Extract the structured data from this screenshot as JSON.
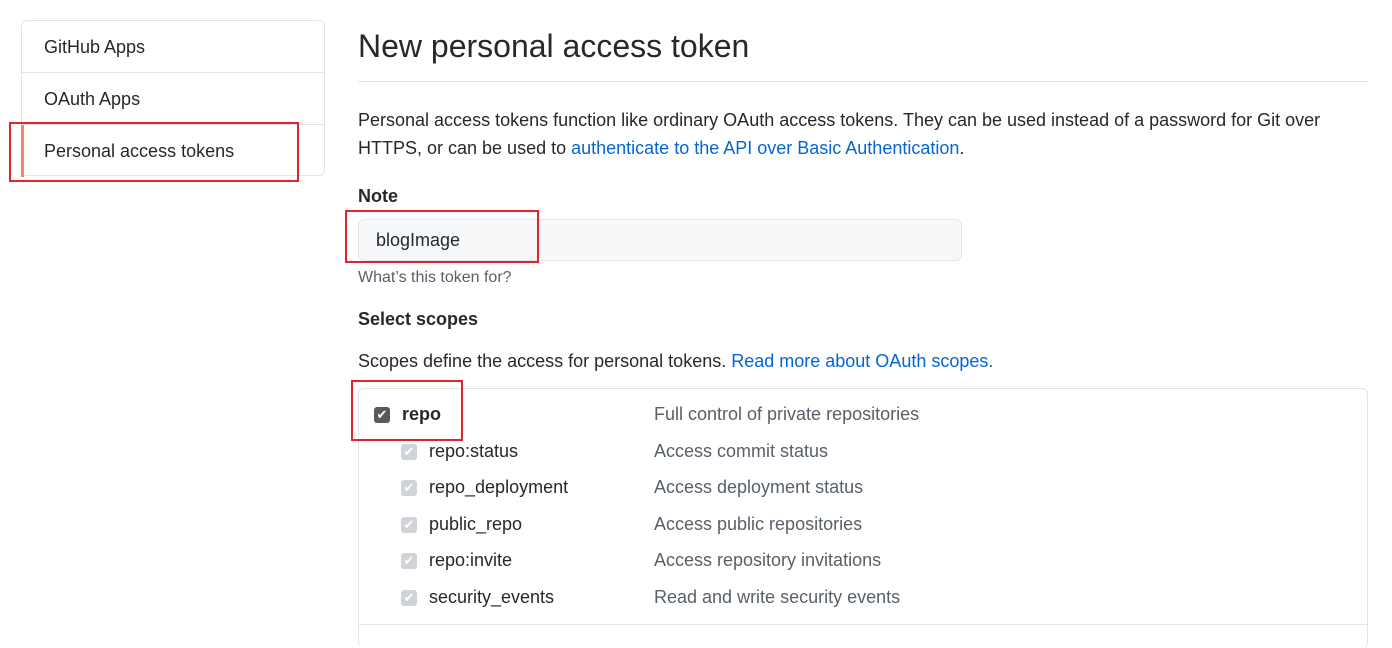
{
  "sidebar": {
    "items": [
      {
        "label": "GitHub Apps"
      },
      {
        "label": "OAuth Apps"
      },
      {
        "label": "Personal access tokens"
      }
    ]
  },
  "main": {
    "title": "New personal access token",
    "intro_text": "Personal access tokens function like ordinary OAuth access tokens. They can be used instead of a password for Git over HTTPS, or can be used to ",
    "intro_link": "authenticate to the API over Basic Authentication",
    "intro_end": ".",
    "note_label": "Note",
    "note_value": "blogImage",
    "note_hint": "What’s this token for?",
    "scopes_label": "Select scopes",
    "scopes_desc": "Scopes define the access for personal tokens. ",
    "scopes_link": "Read more about OAuth scopes."
  },
  "scopes": {
    "parent": {
      "name": "repo",
      "desc": "Full control of private repositories",
      "checked": true
    },
    "children": [
      {
        "name": "repo:status",
        "desc": "Access commit status"
      },
      {
        "name": "repo_deployment",
        "desc": "Access deployment status"
      },
      {
        "name": "public_repo",
        "desc": "Access public repositories"
      },
      {
        "name": "repo:invite",
        "desc": "Access repository invitations"
      },
      {
        "name": "security_events",
        "desc": "Read and write security events"
      }
    ]
  },
  "colors": {
    "accent": "#f9826c",
    "link": "#0366d6",
    "highlight": "#e0242b"
  }
}
